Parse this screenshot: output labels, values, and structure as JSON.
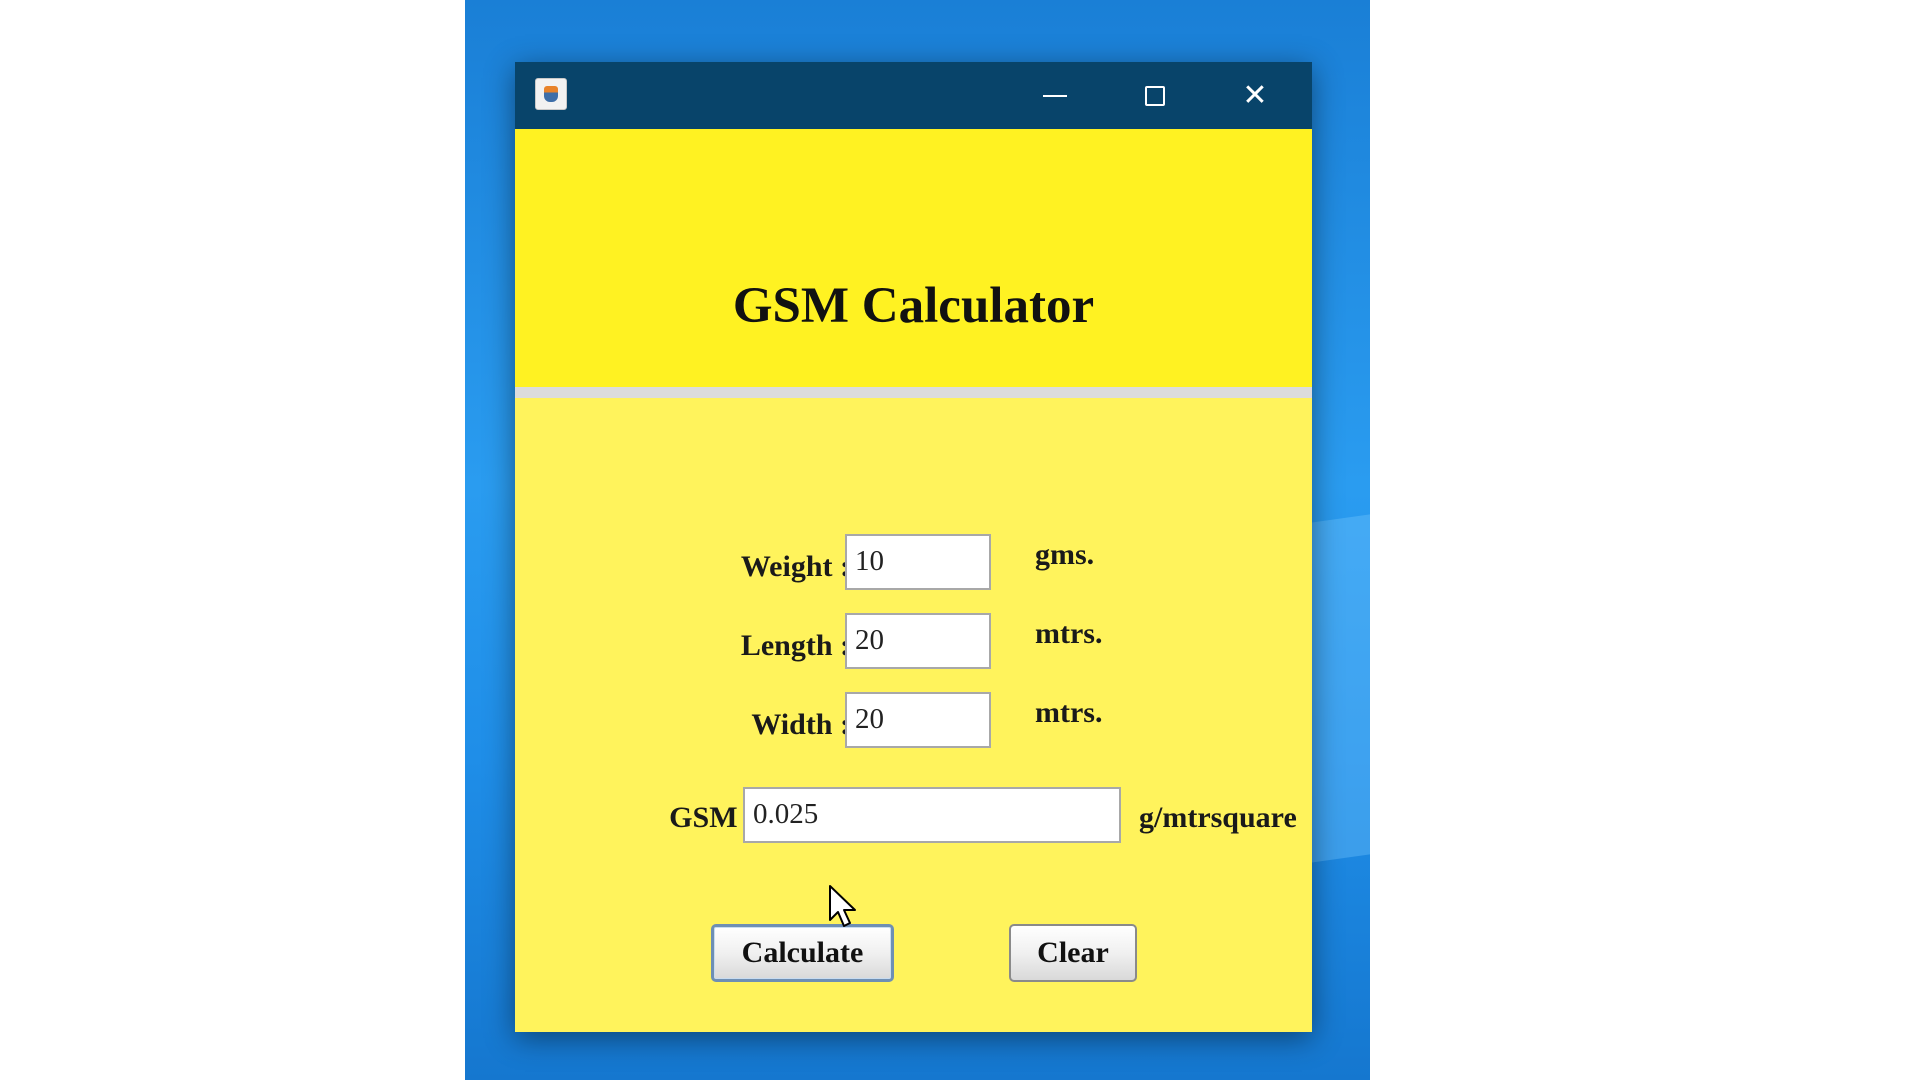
{
  "window": {
    "title": "",
    "controls": {
      "minimize": "minimize-icon",
      "maximize": "maximize-icon",
      "close": "close-icon",
      "close_glyph": "✕"
    }
  },
  "header": {
    "title": "GSM Calculator"
  },
  "form": {
    "weight": {
      "label": "Weight :",
      "value": "10",
      "unit": "gms."
    },
    "length": {
      "label": "Length :",
      "value": "20",
      "unit": "mtrs."
    },
    "width": {
      "label": "Width :",
      "value": "20",
      "unit": "mtrs."
    },
    "gsm": {
      "label": "GSM :",
      "value": "0.025",
      "unit": "g/mtrsquare"
    }
  },
  "buttons": {
    "calculate": "Calculate",
    "clear": "Clear"
  },
  "colors": {
    "titlebar": "#08446a",
    "header_bg": "#fff222",
    "body_bg": "#fff35c",
    "desktop": "#1f8ee8"
  }
}
